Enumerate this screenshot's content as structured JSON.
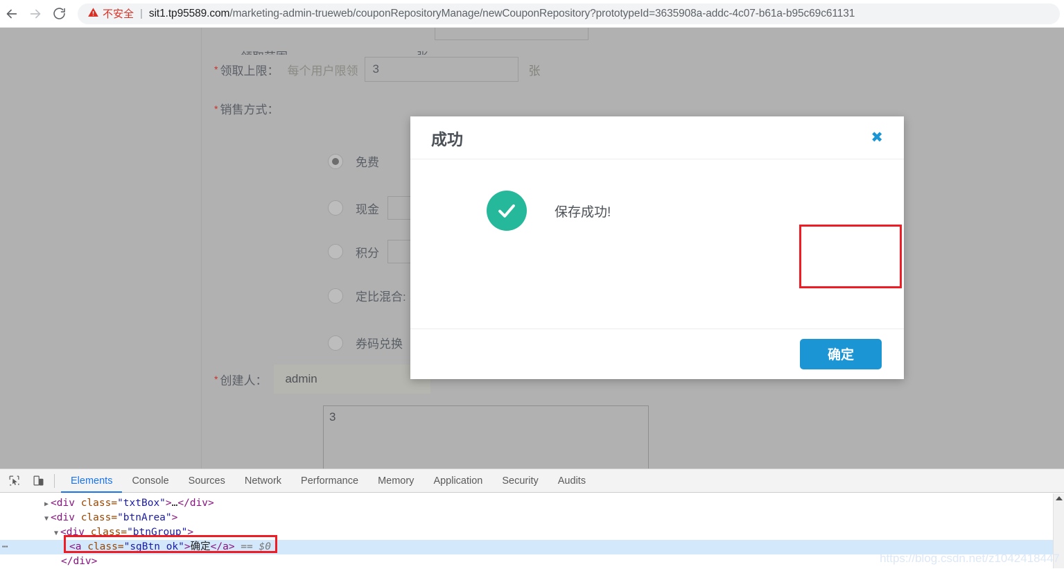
{
  "browser": {
    "back_icon": "arrow-left-icon",
    "forward_icon": "arrow-right-icon",
    "reload_icon": "reload-icon",
    "warning_icon": "warning-triangle-icon",
    "security_label": "不安全",
    "separator": "|",
    "url_host": "sit1.tp95589.com",
    "url_path": "/marketing-admin-trueweb/couponRepositoryManage/newCouponRepository?prototypeId=3635908a-addc-4c07-b61a-b95c69c61131"
  },
  "page": {
    "cut_row": {
      "label": "领取范围",
      "mid": "张"
    },
    "limit_row": {
      "label": "领取上限：",
      "prefix": "每个用户限领",
      "value": "3",
      "unit": "张"
    },
    "sale_row": {
      "label": "销售方式："
    },
    "sale_options": [
      {
        "label": "免费",
        "selected": true,
        "has_input": false
      },
      {
        "label": "现金",
        "selected": false,
        "has_input": true
      },
      {
        "label": "积分",
        "selected": false,
        "has_input": true
      },
      {
        "label": "定比混合:",
        "selected": false,
        "has_input": false
      },
      {
        "label": "券码兑换",
        "selected": false,
        "has_input": false
      }
    ],
    "creator_row": {
      "label": "创建人：",
      "value": "admin"
    },
    "textarea": {
      "value": "3"
    },
    "required_mark": "*"
  },
  "modal": {
    "title": "成功",
    "close_icon": "close-icon",
    "success_icon": "check-circle-icon",
    "message": "保存成功!",
    "ok_label": "确定",
    "accent_color": "#1b95d4",
    "success_color": "#25b89a",
    "highlight_color": "#ee1c24"
  },
  "devtools": {
    "inspect_icon": "inspect-element-icon",
    "device_icon": "device-toolbar-icon",
    "tabs": [
      {
        "label": "Elements",
        "active": true
      },
      {
        "label": "Console",
        "active": false
      },
      {
        "label": "Sources",
        "active": false
      },
      {
        "label": "Network",
        "active": false
      },
      {
        "label": "Performance",
        "active": false
      },
      {
        "label": "Memory",
        "active": false
      },
      {
        "label": "Application",
        "active": false
      },
      {
        "label": "Security",
        "active": false
      },
      {
        "label": "Audits",
        "active": false
      }
    ],
    "tree": [
      {
        "indent": 64,
        "twisty": "▶",
        "parts": [
          {
            "t": "tag",
            "v": "<div "
          },
          {
            "t": "attr",
            "v": "class="
          },
          {
            "t": "val",
            "v": "\"txtBox\""
          },
          {
            "t": "tag",
            "v": ">"
          },
          {
            "t": "txt",
            "v": "…"
          },
          {
            "t": "tag",
            "v": "</div>"
          }
        ]
      },
      {
        "indent": 64,
        "twisty": "▼",
        "parts": [
          {
            "t": "tag",
            "v": "<div "
          },
          {
            "t": "attr",
            "v": "class="
          },
          {
            "t": "val",
            "v": "\"btnArea\""
          },
          {
            "t": "tag",
            "v": ">"
          }
        ]
      },
      {
        "indent": 78,
        "twisty": "▼",
        "parts": [
          {
            "t": "tag",
            "v": "<div "
          },
          {
            "t": "attr",
            "v": "class="
          },
          {
            "t": "val",
            "v": "\"btnGroup\""
          },
          {
            "t": "tag",
            "v": ">"
          }
        ]
      },
      {
        "indent": 100,
        "twisty": "",
        "selected": true,
        "ellipsis": "…",
        "parts": [
          {
            "t": "tag",
            "v": "<a "
          },
          {
            "t": "attr",
            "v": "class="
          },
          {
            "t": "val",
            "v": "\"sgBtn ok\""
          },
          {
            "t": "tag",
            "v": ">"
          },
          {
            "t": "txt",
            "v": "确定"
          },
          {
            "t": "tag",
            "v": "</a>"
          },
          {
            "t": "dollar",
            "v": " == $0"
          }
        ]
      },
      {
        "indent": 88,
        "twisty": "",
        "parts": [
          {
            "t": "tag",
            "v": "</div>"
          }
        ]
      }
    ]
  },
  "watermark": {
    "text": "https://blog.csdn.net/z1042418447"
  }
}
